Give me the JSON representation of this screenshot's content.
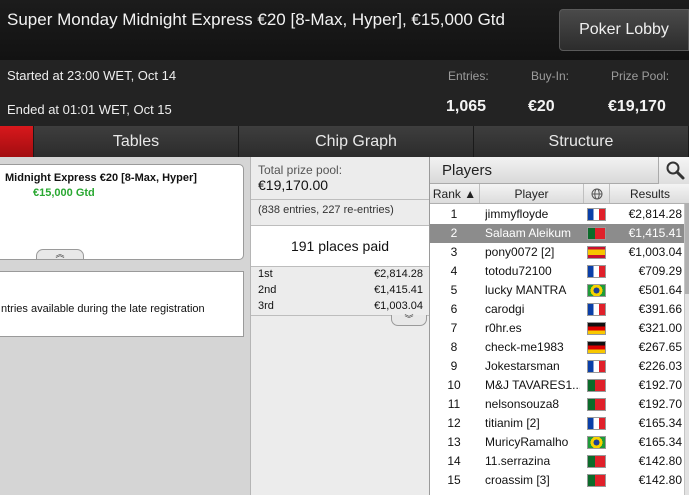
{
  "header": {
    "title": "Super Monday Midnight Express €20 [8-Max, Hyper], €15,000 Gtd",
    "lobby_button": "Poker Lobby"
  },
  "info": {
    "started": "Started at 23:00 WET, Oct 14",
    "ended": "Ended at 01:01 WET, Oct 15",
    "entries_label": "Entries:",
    "entries_value": "1,065",
    "buyin_label": "Buy-In:",
    "buyin_value": "€20",
    "prize_label": "Prize Pool:",
    "prize_value": "€19,170"
  },
  "tabs": [
    "Tables",
    "Chip Graph",
    "Structure"
  ],
  "left": {
    "name": "Midnight Express €20 [8-Max, Hyper]",
    "gtd": "€15,000 Gtd",
    "toggle": "︽",
    "late_reg": "ntries available during the late registration"
  },
  "prize": {
    "label": "Total prize pool:",
    "value": "€19,170.00",
    "entries": "(838 entries, 227 re-entries)",
    "places": "191 places paid",
    "payouts": [
      {
        "place": "1st",
        "amount": "€2,814.28"
      },
      {
        "place": "2nd",
        "amount": "€1,415.41"
      },
      {
        "place": "3rd",
        "amount": "€1,003.04"
      }
    ],
    "toggle": "︾"
  },
  "players": {
    "title": "Players",
    "cols": {
      "rank": "Rank ▲",
      "player": "Player",
      "results": "Results"
    },
    "rows": [
      {
        "rank": "1",
        "name": "jimmyfloyde",
        "flag": "fr",
        "result": "€2,814.28"
      },
      {
        "rank": "2",
        "name": "Salaam Aleikum",
        "flag": "pt",
        "result": "€1,415.41"
      },
      {
        "rank": "3",
        "name": "pony0072 [2]",
        "flag": "es",
        "result": "€1,003.04"
      },
      {
        "rank": "4",
        "name": "totodu72100",
        "flag": "fr",
        "result": "€709.29"
      },
      {
        "rank": "5",
        "name": "lucky MANTRA",
        "flag": "br",
        "result": "€501.64"
      },
      {
        "rank": "6",
        "name": "carodgi",
        "flag": "fr",
        "result": "€391.66"
      },
      {
        "rank": "7",
        "name": "r0hr.es",
        "flag": "de",
        "result": "€321.00"
      },
      {
        "rank": "8",
        "name": "check-me1983",
        "flag": "de",
        "result": "€267.65"
      },
      {
        "rank": "9",
        "name": "Jokestarsman",
        "flag": "fr",
        "result": "€226.03"
      },
      {
        "rank": "10",
        "name": "M&J TAVARES1...",
        "flag": "pt",
        "result": "€192.70"
      },
      {
        "rank": "11",
        "name": "nelsonsouza8",
        "flag": "pt",
        "result": "€192.70"
      },
      {
        "rank": "12",
        "name": "titianim [2]",
        "flag": "fr",
        "result": "€165.34"
      },
      {
        "rank": "13",
        "name": "MuricyRamalho",
        "flag": "br",
        "result": "€165.34"
      },
      {
        "rank": "14",
        "name": "11.serrazina",
        "flag": "pt",
        "result": "€142.80"
      },
      {
        "rank": "15",
        "name": "croassim [3]",
        "flag": "pt",
        "result": "€142.80"
      }
    ]
  }
}
